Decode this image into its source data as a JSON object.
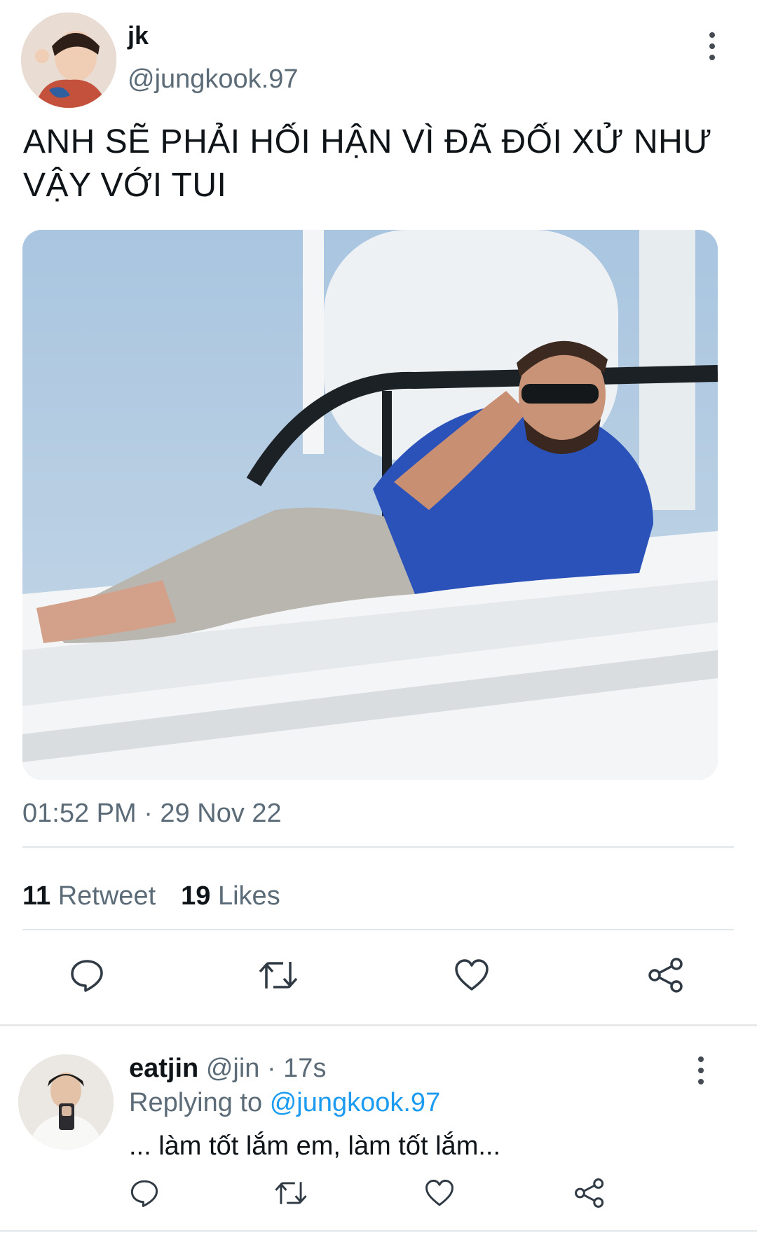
{
  "tweet": {
    "author_name": "jk",
    "author_handle": "@jungkook.97",
    "text": "ANH SẼ PHẢI HỐI HẬN VÌ ĐÃ ĐỐI XỬ NHƯ VẬY VỚI TUI",
    "timestamp": "01:52 PM · 29 Nov 22",
    "retweet_count": "11",
    "retweet_label": "Retweet",
    "likes_count": "19",
    "likes_label": "Likes"
  },
  "reply": {
    "author_name": "eatjin",
    "author_handle": "@jin · 17s",
    "replying_prefix": "Replying to",
    "replying_handle": "@jungkook.97",
    "text": "... làm tốt lắm em, làm tốt lắm..."
  },
  "colors": {
    "primary_text": "#0f1419",
    "secondary_text": "#5b6b77",
    "link": "#1d9bf0",
    "icon": "#2f3a44"
  },
  "icons": {
    "reply": "reply-icon",
    "retweet": "retweet-icon",
    "like": "heart-icon",
    "share": "share-icon",
    "more": "more-options-icon"
  }
}
